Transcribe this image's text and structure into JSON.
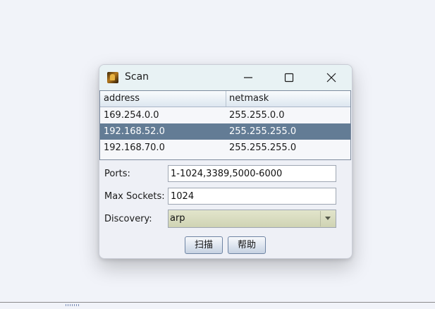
{
  "window": {
    "title": "Scan"
  },
  "table": {
    "columns": [
      "address",
      "netmask"
    ],
    "rows": [
      {
        "address": "169.254.0.0",
        "netmask": "255.255.0.0",
        "selected": false
      },
      {
        "address": "192.168.52.0",
        "netmask": "255.255.255.0",
        "selected": true
      },
      {
        "address": "192.168.70.0",
        "netmask": "255.255.255.0",
        "selected": false
      }
    ]
  },
  "form": {
    "ports_label": "Ports:",
    "ports_value": "1-1024,3389,5000-6000",
    "max_sockets_label": "Max Sockets:",
    "max_sockets_value": "1024",
    "discovery_label": "Discovery:",
    "discovery_value": "arp"
  },
  "buttons": {
    "scan_label": "扫描",
    "help_label": "帮助"
  },
  "colors": {
    "selection": "#637c95",
    "titlebar": "#e8f2f4",
    "desktop": "#f1f3f9"
  }
}
